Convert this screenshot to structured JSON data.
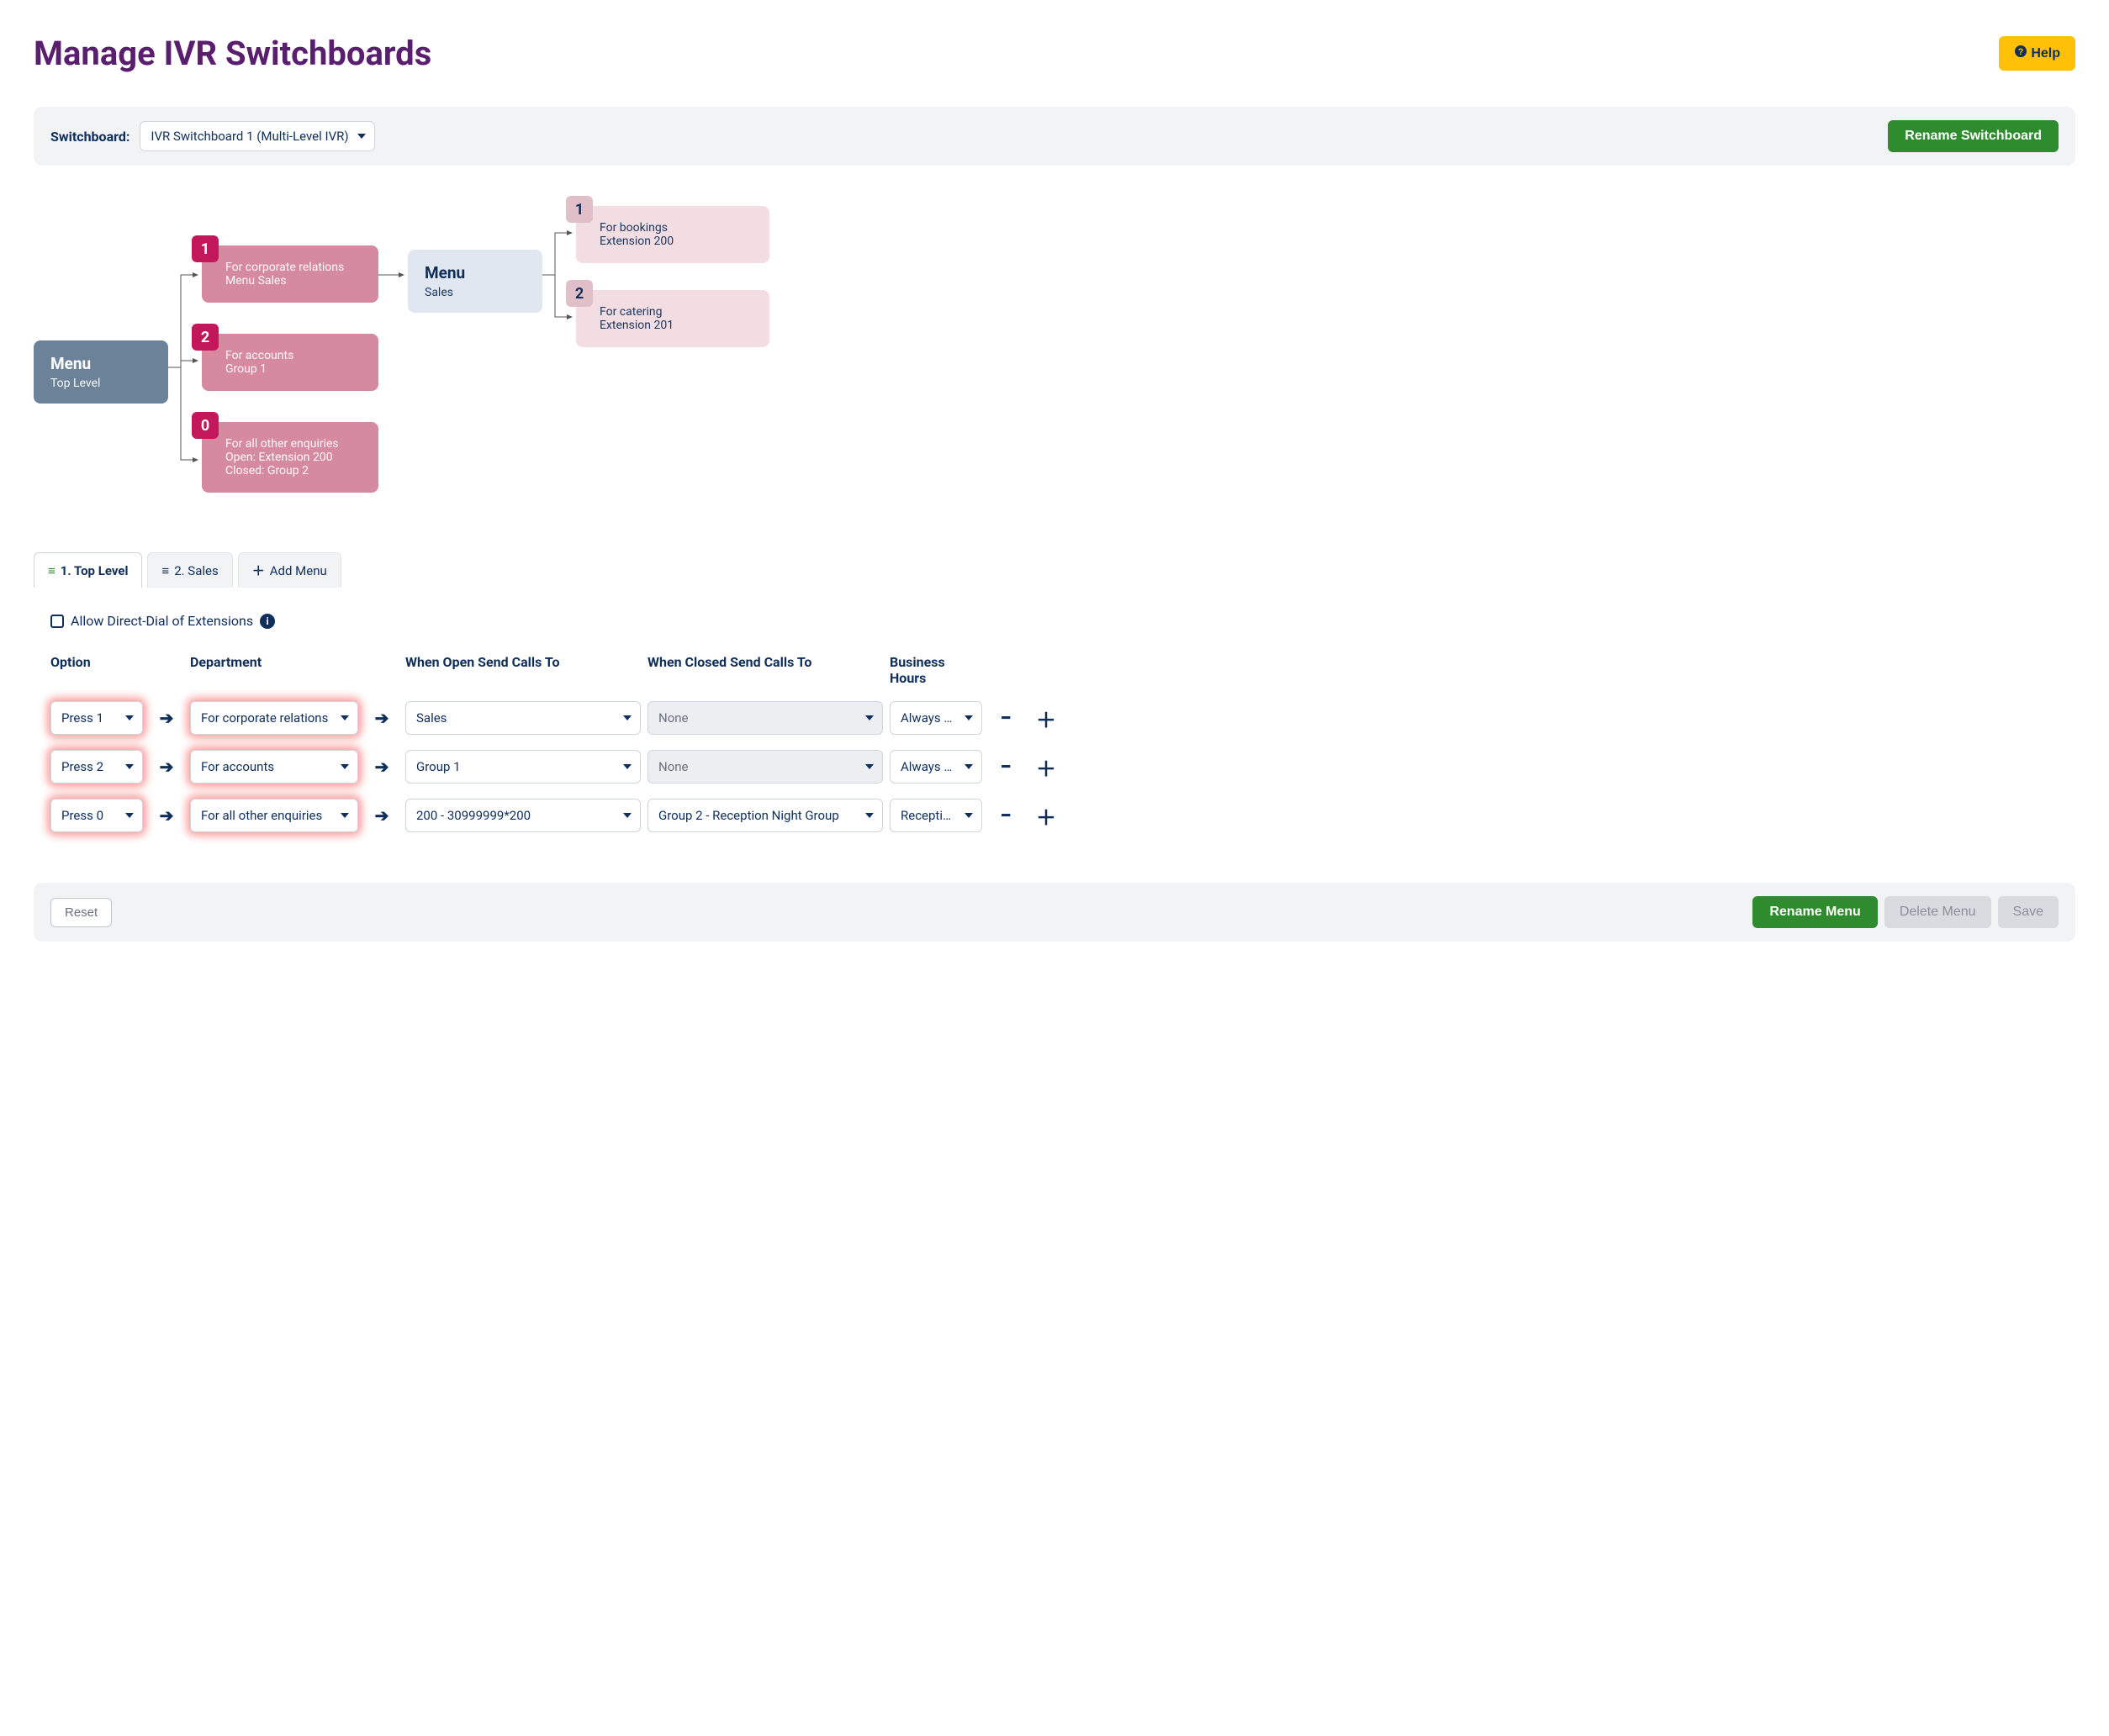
{
  "header": {
    "title": "Manage IVR Switchboards",
    "help_label": "Help"
  },
  "switchboard_bar": {
    "label": "Switchboard:",
    "selected": "IVR Switchboard 1 (Multi-Level IVR)",
    "rename_label": "Rename Switchboard"
  },
  "diagram": {
    "root": {
      "title": "Menu",
      "sub": "Top Level"
    },
    "level1": [
      {
        "badge": "1",
        "line1": "For corporate relations",
        "line2": "Menu Sales"
      },
      {
        "badge": "2",
        "line1": "For accounts",
        "line2": "Group 1"
      },
      {
        "badge": "0",
        "line1": "For all other enquiries",
        "line2": "Open: Extension 200",
        "line3": "Closed: Group 2"
      }
    ],
    "menu2": {
      "title": "Menu",
      "sub": "Sales"
    },
    "level2": [
      {
        "badge": "1",
        "line1": "For bookings",
        "line2": "Extension 200"
      },
      {
        "badge": "2",
        "line1": "For catering",
        "line2": "Extension 201"
      }
    ]
  },
  "tabs": [
    {
      "label": "1. Top Level",
      "active": true
    },
    {
      "label": "2. Sales",
      "active": false
    },
    {
      "label": "Add Menu",
      "active": false
    }
  ],
  "form": {
    "checkbox_label": "Allow Direct-Dial of Extensions",
    "headers": {
      "option": "Option",
      "department": "Department",
      "when_open": "When Open Send Calls To",
      "when_closed": "When Closed Send Calls To",
      "business_hours": "Business Hours"
    },
    "rows": [
      {
        "option": "Press 1",
        "department": "For corporate relations",
        "when_open": "Sales",
        "when_closed": "None",
        "when_closed_disabled": true,
        "business_hours": "Always Open"
      },
      {
        "option": "Press 2",
        "department": "For accounts",
        "when_open": "Group 1",
        "when_closed": "None",
        "when_closed_disabled": true,
        "business_hours": "Always Open"
      },
      {
        "option": "Press 0",
        "department": "For all other enquiries",
        "when_open": "200 - 30999999*200",
        "when_closed": "Group 2 - Reception Night Group",
        "when_closed_disabled": false,
        "business_hours": "Reception"
      }
    ]
  },
  "footer": {
    "reset_label": "Reset",
    "rename_menu_label": "Rename Menu",
    "delete_menu_label": "Delete Menu",
    "save_label": "Save"
  }
}
